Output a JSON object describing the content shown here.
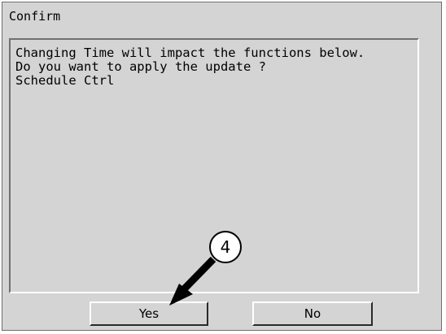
{
  "dialog": {
    "title": "Confirm",
    "message_lines": [
      "Changing Time will impact the functions below.",
      "Do you want to apply the update ?",
      "Schedule Ctrl"
    ],
    "buttons": {
      "yes_label": "Yes",
      "no_label": "No"
    }
  },
  "annotation": {
    "step_number": "4"
  },
  "colors": {
    "dialog_background": "#d4d4d4",
    "text": "#000000",
    "callout": "#000000"
  }
}
